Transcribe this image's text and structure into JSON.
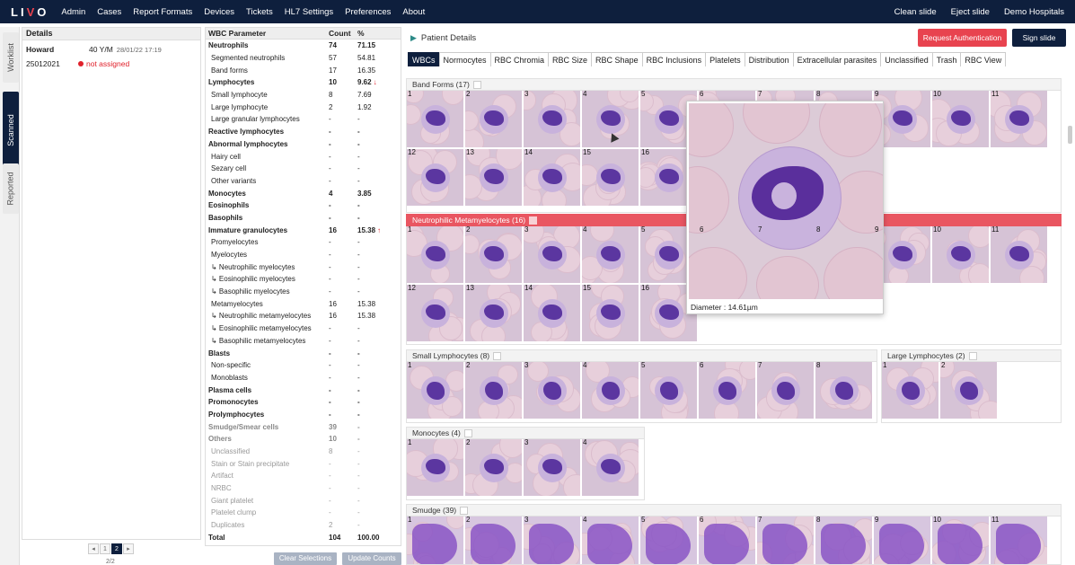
{
  "topbar": {
    "logo_main": "LI",
    "logo_v": "V",
    "logo_end": "O",
    "nav": [
      "Admin",
      "Cases",
      "Report Formats",
      "Devices",
      "Tickets",
      "HL7 Settings",
      "Preferences",
      "About"
    ],
    "right": [
      "Clean slide",
      "Eject slide",
      "Demo Hospitals"
    ]
  },
  "sidebar_tabs": [
    "Worklist",
    "Scanned",
    "Reported"
  ],
  "details": {
    "title": "Details",
    "patient_name": "Howard",
    "age_sex": "40 Y/M",
    "datetime": "28/01/22 17:19",
    "case_id": "25012021",
    "assign_status": "not assigned",
    "pages": [
      "1",
      "2"
    ],
    "page_text": "2/2"
  },
  "wbc_table": {
    "headers": [
      "WBC Parameter",
      "Count",
      "%"
    ],
    "rows": [
      {
        "name": "Neutrophils",
        "count": "74",
        "pct": "71.15",
        "bold": true
      },
      {
        "name": "Segmented neutrophils",
        "count": "57",
        "pct": "54.81",
        "sub": true
      },
      {
        "name": "Band forms",
        "count": "17",
        "pct": "16.35",
        "sub": true
      },
      {
        "name": "Lymphocytes",
        "count": "10",
        "pct": "9.62",
        "bold": true,
        "flag": "↓"
      },
      {
        "name": "Small lymphocyte",
        "count": "8",
        "pct": "7.69",
        "sub": true
      },
      {
        "name": "Large lymphocyte",
        "count": "2",
        "pct": "1.92",
        "sub": true
      },
      {
        "name": "Large granular lymphocytes",
        "count": "-",
        "pct": "-",
        "sub": true
      },
      {
        "name": "Reactive lymphocytes",
        "count": "-",
        "pct": "-",
        "bold": true
      },
      {
        "name": "Abnormal lymphocytes",
        "count": "-",
        "pct": "-",
        "bold": true
      },
      {
        "name": "Hairy cell",
        "count": "-",
        "pct": "-",
        "sub": true
      },
      {
        "name": "Sezary cell",
        "count": "-",
        "pct": "-",
        "sub": true
      },
      {
        "name": "Other variants",
        "count": "-",
        "pct": "-",
        "sub": true
      },
      {
        "name": "Monocytes",
        "count": "4",
        "pct": "3.85",
        "bold": true
      },
      {
        "name": "Eosinophils",
        "count": "-",
        "pct": "-",
        "bold": true
      },
      {
        "name": "Basophils",
        "count": "-",
        "pct": "-",
        "bold": true
      },
      {
        "name": "Immature granulocytes",
        "count": "16",
        "pct": "15.38",
        "bold": true,
        "flag": "↑"
      },
      {
        "name": "Promyelocytes",
        "count": "-",
        "pct": "-",
        "sub": true
      },
      {
        "name": "Myelocytes",
        "count": "-",
        "pct": "-",
        "sub": true
      },
      {
        "name": "↳ Neutrophilic myelocytes",
        "count": "-",
        "pct": "-",
        "sub": true
      },
      {
        "name": "↳ Eosinophilic myelocytes",
        "count": "-",
        "pct": "-",
        "sub": true
      },
      {
        "name": "↳ Basophilic myelocytes",
        "count": "-",
        "pct": "-",
        "sub": true
      },
      {
        "name": "Metamyelocytes",
        "count": "16",
        "pct": "15.38",
        "sub": true
      },
      {
        "name": "↳ Neutrophilic metamyelocytes",
        "count": "16",
        "pct": "15.38",
        "sub": true
      },
      {
        "name": "↳ Eosinophilic metamyelocytes",
        "count": "-",
        "pct": "-",
        "sub": true
      },
      {
        "name": "↳ Basophilic metamyelocytes",
        "count": "-",
        "pct": "-",
        "sub": true
      },
      {
        "name": "Blasts",
        "count": "-",
        "pct": "-",
        "bold": true
      },
      {
        "name": "Non-specific",
        "count": "-",
        "pct": "-",
        "sub": true
      },
      {
        "name": "Monoblasts",
        "count": "-",
        "pct": "-",
        "sub": true
      },
      {
        "name": "Plasma cells",
        "count": "-",
        "pct": "-",
        "bold": true
      },
      {
        "name": "Promonocytes",
        "count": "-",
        "pct": "-",
        "bold": true
      },
      {
        "name": "Prolymphocytes",
        "count": "-",
        "pct": "-",
        "bold": true
      },
      {
        "name": "Smudge/Smear cells",
        "count": "39",
        "pct": "-",
        "bold": true,
        "grey": true
      },
      {
        "name": "Others",
        "count": "10",
        "pct": "-",
        "bold": true,
        "grey": true
      },
      {
        "name": "Unclassified",
        "count": "8",
        "pct": "-",
        "sub": true,
        "grey": true
      },
      {
        "name": "Stain or Stain precipitate",
        "count": "-",
        "pct": "-",
        "sub": true,
        "grey": true
      },
      {
        "name": "Artifact",
        "count": "-",
        "pct": "-",
        "sub": true,
        "grey": true
      },
      {
        "name": "NRBC",
        "count": "-",
        "pct": "-",
        "sub": true,
        "grey": true
      },
      {
        "name": "Giant platelet",
        "count": "-",
        "pct": "-",
        "sub": true,
        "grey": true
      },
      {
        "name": "Platelet clump",
        "count": "-",
        "pct": "-",
        "sub": true,
        "grey": true
      },
      {
        "name": "Duplicates",
        "count": "2",
        "pct": "-",
        "sub": true,
        "grey": true
      },
      {
        "name": "Total",
        "count": "104",
        "pct": "100.00",
        "bold": true
      }
    ],
    "clear_btn": "Clear Selections",
    "update_btn": "Update Counts"
  },
  "main": {
    "panel_title": "Patient Details",
    "request_btn": "Request Authentication",
    "sign_btn": "Sign slide",
    "tabs": [
      "WBCs",
      "Normocytes",
      "RBC Chromia",
      "RBC Size",
      "RBC Shape",
      "RBC Inclusions",
      "Platelets",
      "Distribution",
      "Extracellular parasites",
      "Unclassified",
      "Trash",
      "RBC View"
    ],
    "sections": {
      "band": "Band Forms (17)",
      "meta": "Neutrophilic Metamyelocytes (16)",
      "small": "Small Lymphocytes (8)",
      "large": "Large Lymphocytes (2)",
      "mono": "Monocytes (4)",
      "smudge": "Smudge (39)"
    },
    "zoom_caption": "Diameter : 14.61µm"
  }
}
